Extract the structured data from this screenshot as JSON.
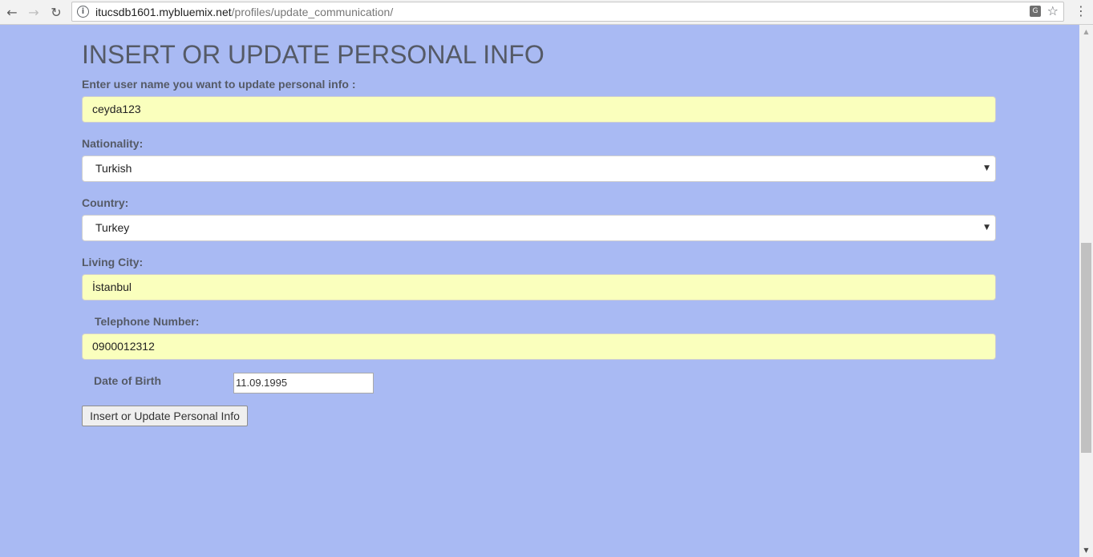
{
  "browser": {
    "url_host": "itucsdb1601.mybluemix.net",
    "url_path": "/profiles/update_communication/"
  },
  "form": {
    "title": "INSERT OR UPDATE PERSONAL INFO",
    "username_label": "Enter user name you want to update personal info :",
    "username_value": "ceyda123",
    "nationality_label": "Nationality:",
    "nationality_value": "Turkish",
    "country_label": "Country:",
    "country_value": "Turkey",
    "city_label": "Living City:",
    "city_value": "İstanbul",
    "phone_label": "Telephone Number:",
    "phone_value": "0900012312",
    "dob_label": "Date of Birth",
    "dob_value": "11.09.1995",
    "submit_label": "Insert or Update Personal Info"
  },
  "colors": {
    "page_background": "#a9baf3",
    "autofill_yellow": "#faffbd",
    "text": "#555a66"
  },
  "icons": [
    "back-arrow-icon",
    "forward-arrow-icon",
    "reload-icon",
    "info-icon",
    "translate-icon",
    "star-icon",
    "menu-icon",
    "chevron-down-icon"
  ]
}
